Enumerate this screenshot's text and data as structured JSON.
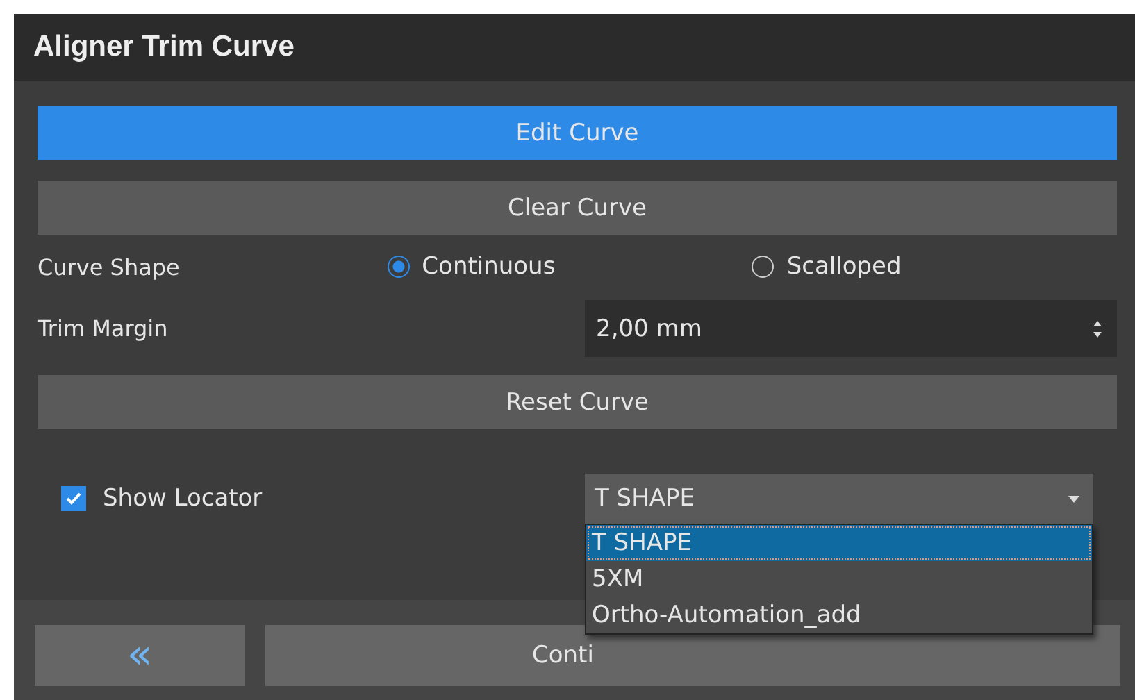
{
  "window": {
    "title": "Aligner Trim Curve"
  },
  "buttons": [
    {
      "label": "Edit Curve",
      "kind": "primary"
    },
    {
      "label": "Clear Curve",
      "kind": "normal"
    }
  ],
  "curve_shape": {
    "label": "Curve Shape",
    "options": [
      {
        "label": "Continuous",
        "selected": true
      },
      {
        "label": "Scalloped",
        "selected": false
      }
    ]
  },
  "trim_margin": {
    "label": "Trim Margin",
    "value": "2,00 mm"
  },
  "reset_button": {
    "label": "Reset Curve"
  },
  "show_locator": {
    "label": "Show Locator",
    "checked": true,
    "value": "T SHAPE",
    "expanded": true,
    "options": [
      {
        "label": "T SHAPE",
        "selected": true
      },
      {
        "label": "5XM",
        "selected": false
      },
      {
        "label": "Ortho-Automation_add",
        "selected": false
      }
    ]
  },
  "footer": {
    "back_label": "«",
    "continue_label": "Conti"
  }
}
